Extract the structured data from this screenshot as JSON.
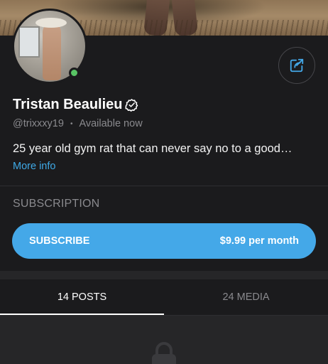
{
  "profile": {
    "name": "Tristan Beaulieu",
    "handle": "@trixxxy19",
    "status": "Available now",
    "bio": "25 year old gym rat that can never say no to a good…",
    "more_info": "More info"
  },
  "subscription": {
    "title": "SUBSCRIPTION",
    "button_label": "SUBSCRIBE",
    "price": "$9.99 per month"
  },
  "tabs": [
    {
      "label": "14 POSTS",
      "active": true
    },
    {
      "label": "24 MEDIA",
      "active": false
    }
  ],
  "icons": {
    "share": "share-icon",
    "verified": "verified-check-icon",
    "lock": "lock-icon"
  },
  "colors": {
    "accent": "#44a8e8",
    "link": "#3fa9e6",
    "online": "#58c464",
    "background": "#1b1b1d"
  }
}
